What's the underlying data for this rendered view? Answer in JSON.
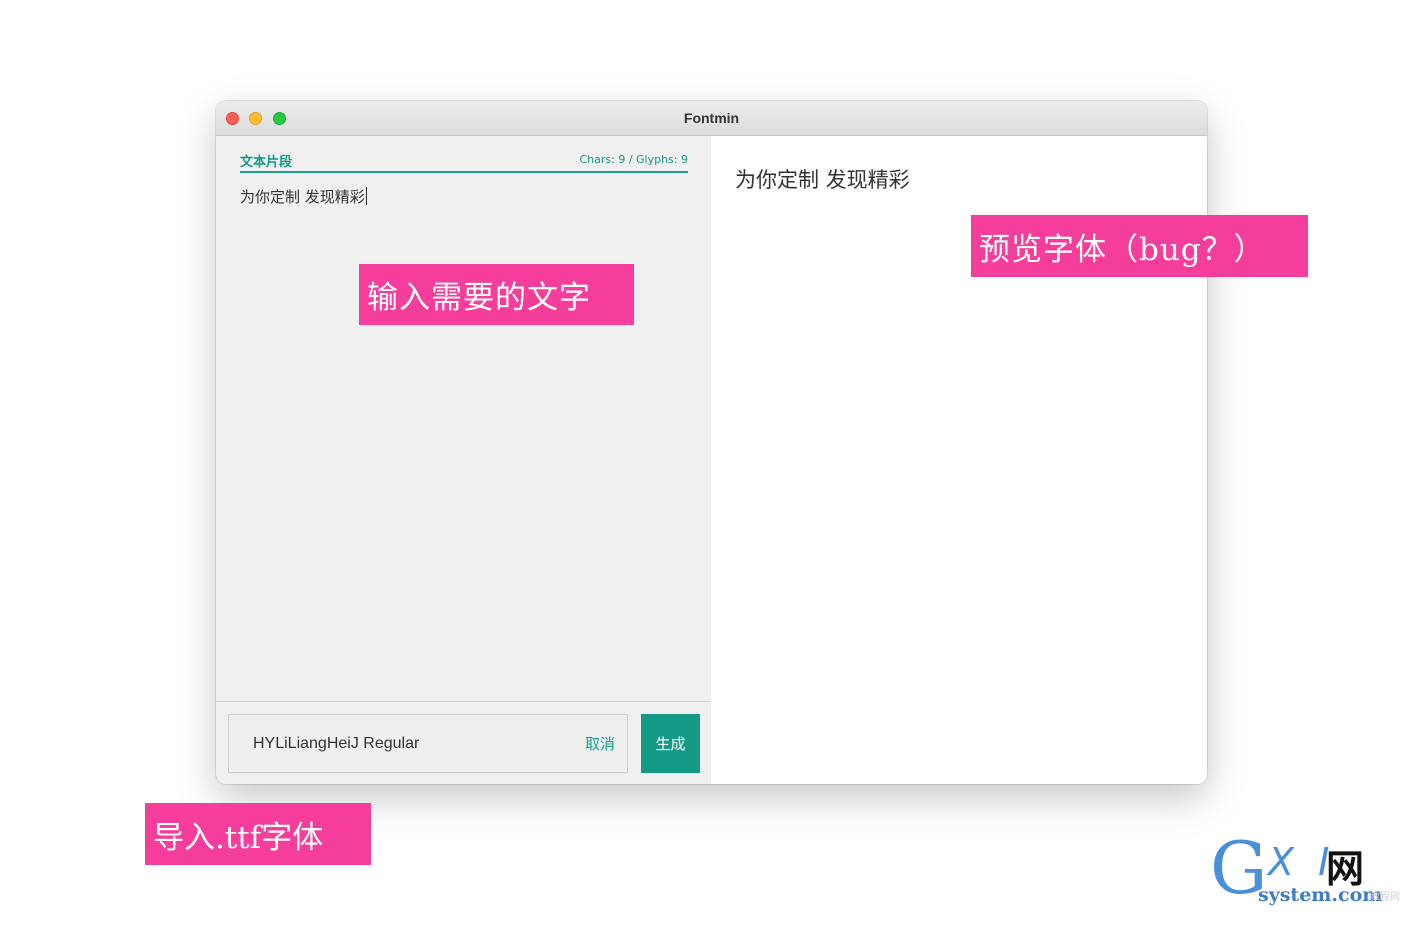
{
  "window": {
    "title": "Fontmin"
  },
  "editor": {
    "section_label": "文本片段",
    "counts": "Chars: 9 / Glyphs: 9",
    "text": "为你定制 发现精彩"
  },
  "font_bar": {
    "font_name": "HYLiLiangHeiJ Regular",
    "cancel_label": "取消",
    "generate_label": "生成"
  },
  "preview": {
    "text": "为你定制 发现精彩"
  },
  "annotations": {
    "input_text": "输入需要的文字",
    "preview_font": "预览字体（bug？）",
    "import_font": "导入.ttf字体"
  },
  "watermark": {
    "logo_g": "G",
    "logo_xi": "X I",
    "logo_net": "网",
    "domain": "system.com",
    "faint": "教程网"
  },
  "colors": {
    "accent": "#149a85",
    "annotation": "#f53d9c",
    "close": "#fe5f57",
    "minimize": "#febc2e",
    "zoom": "#28c840"
  }
}
